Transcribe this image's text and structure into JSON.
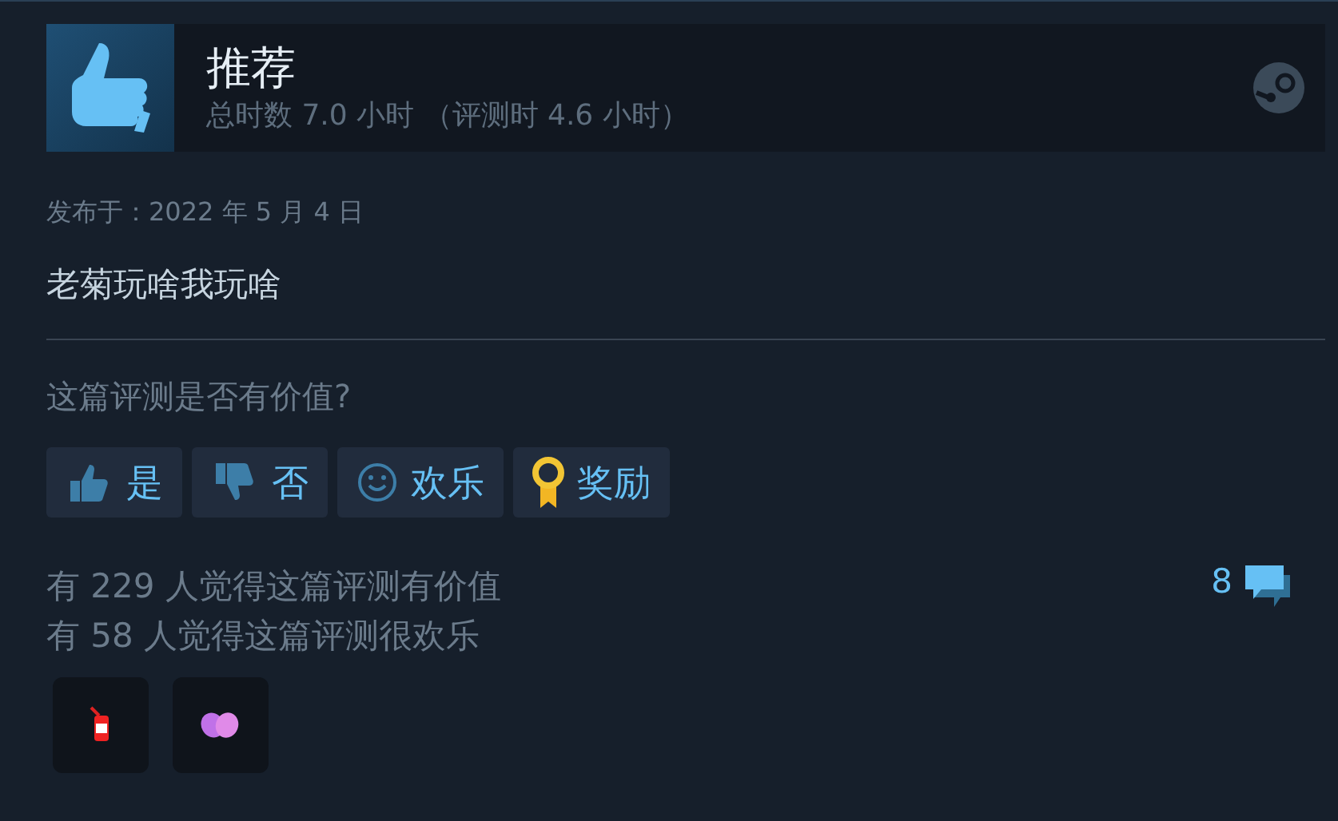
{
  "header": {
    "title": "推荐",
    "playtime": "总时数 7.0 小时 （评测时 4.6 小时）"
  },
  "review": {
    "posted": "发布于：2022 年 5 月 4 日",
    "text": "老菊玩啥我玩啥"
  },
  "helpful_prompt": "这篇评测是否有价值?",
  "buttons": [
    {
      "kind": "thumbs-up",
      "label": "是"
    },
    {
      "kind": "thumbs-down",
      "label": "否"
    },
    {
      "kind": "smile",
      "label": "欢乐"
    },
    {
      "kind": "award",
      "label": "奖励"
    }
  ],
  "stats": [
    "有 229 人觉得这篇评测有价值",
    "有 58 人觉得这篇评测很欢乐"
  ],
  "comments": {
    "count": "8"
  },
  "awards": [
    {
      "kind": "bottle"
    },
    {
      "kind": "hands"
    }
  ]
}
